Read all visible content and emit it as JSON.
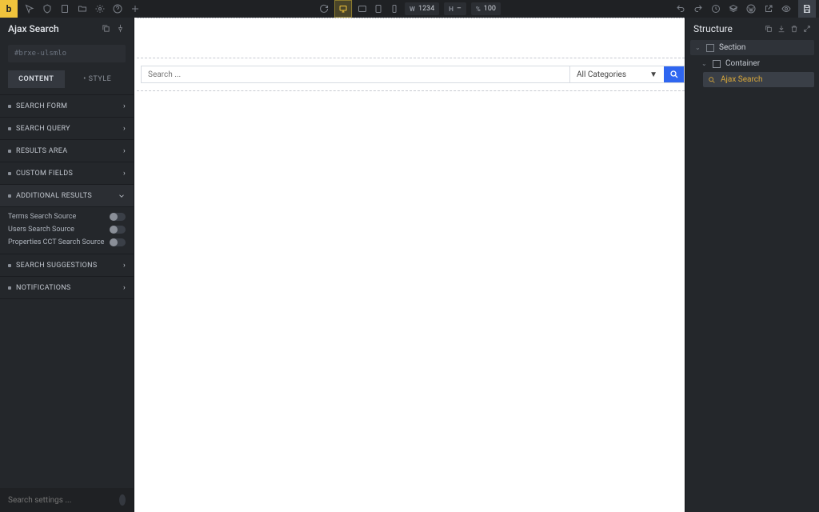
{
  "topbar": {
    "logo": "b",
    "dims": {
      "w_label": "W",
      "w_value": "1234",
      "h_label": "H",
      "h_value": "–",
      "pct_label": "%",
      "pct_value": "100"
    }
  },
  "left": {
    "title": "Ajax Search",
    "id": "#brxe-ulsmlo",
    "tabs": {
      "content": "CONTENT",
      "style": "STYLE",
      "style_prefix": "•"
    },
    "sections": [
      {
        "label": "SEARCH FORM"
      },
      {
        "label": "SEARCH QUERY"
      },
      {
        "label": "RESULTS AREA"
      },
      {
        "label": "CUSTOM FIELDS"
      },
      {
        "label": "ADDITIONAL RESULTS",
        "open": true
      },
      {
        "label": "SEARCH SUGGESTIONS"
      },
      {
        "label": "NOTIFICATIONS"
      }
    ],
    "toggles": [
      "Terms Search Source",
      "Users Search Source",
      "Properties CCT Search Source"
    ],
    "search_placeholder": "Search settings ..."
  },
  "canvas": {
    "search_placeholder": "Search ...",
    "category": "All Categories"
  },
  "right": {
    "title": "Structure",
    "tree": {
      "section": "Section",
      "container": "Container",
      "element": "Ajax Search"
    }
  }
}
